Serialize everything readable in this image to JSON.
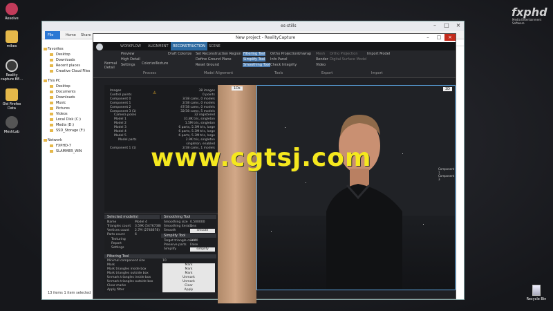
{
  "desktop": {
    "icons": [
      {
        "label": "Resolve",
        "color": "#c23b5a"
      },
      {
        "label": "mikes",
        "color": "#e5b84a"
      },
      {
        "label": "Reality capture BE...",
        "color": "#3a3a3a"
      },
      {
        "label": "Old Firefox Data",
        "color": "#e5b84a"
      },
      {
        "label": "MeshLab",
        "color": "#555"
      }
    ],
    "watermark": "fxphd",
    "watermark_sub": "Media Entertainment Software",
    "recycle_bin": "Recycle Bin",
    "overlay_text": "www.cgtsj.com"
  },
  "explorer": {
    "title": "es-stills",
    "tabs": [
      "File",
      "Home",
      "Share"
    ],
    "nav": [
      {
        "label": "Favorites",
        "h": true
      },
      {
        "label": "Desktop"
      },
      {
        "label": "Downloads"
      },
      {
        "label": "Recent places"
      },
      {
        "label": "Creative Cloud Files"
      },
      {
        "label": "This PC",
        "h": true
      },
      {
        "label": "Desktop"
      },
      {
        "label": "Documents"
      },
      {
        "label": "Downloads"
      },
      {
        "label": "Music"
      },
      {
        "label": "Pictures"
      },
      {
        "label": "Videos"
      },
      {
        "label": "Local Disk (C:)"
      },
      {
        "label": "Media (D:)"
      },
      {
        "label": "SSD_Storage (F:)"
      },
      {
        "label": "Network",
        "h": true
      },
      {
        "label": "FXPHD-7"
      },
      {
        "label": "SLAMMER_WIN"
      }
    ],
    "status": "13 items    1 item selected"
  },
  "rc": {
    "title": "New project - RealityCapture",
    "menu": [
      "WORKFLOW",
      "ALIGNMENT",
      "RECONSTRUCTION",
      "SCENE"
    ],
    "ribbon": {
      "col1": [
        "Normal Detail"
      ],
      "col2": [
        "Preview",
        "High Detail",
        "Settings"
      ],
      "col3": [
        "Colorize",
        "Texture"
      ],
      "col4": [
        "Draft Colorize"
      ],
      "col5": [
        "Set Reconstruction Region",
        "Define Ground Plane",
        "Reset Ground"
      ],
      "col6": [
        "Filtering Tool",
        "Simplify Tool",
        "Smoothing Tool"
      ],
      "col7": [
        "Ortho Projection",
        "Info Panel",
        "Check Integrity"
      ],
      "col8": [
        "Unwrap"
      ],
      "col9": [
        "Mesh",
        "Render",
        "Video"
      ],
      "col10": [
        "Ortho Projection",
        "Digital Surface Model"
      ],
      "col11": [
        "Import Model"
      ],
      "sections": [
        "Process",
        "Model Alignment",
        "Tools",
        "Export",
        "Import"
      ]
    },
    "tree": [
      {
        "k": "Images",
        "v": "38 images"
      },
      {
        "k": "Control points",
        "v": "0 points"
      },
      {
        "k": "Component 0",
        "v": "3/38 cams, 0 models"
      },
      {
        "k": "Component 1",
        "v": "2/38 cams, 0 models"
      },
      {
        "k": "Component 2",
        "v": "47/38 cams, 0 models"
      },
      {
        "k": "Component 3 (1)",
        "v": "32/38 cams, 5 models"
      },
      {
        "k": "Camera poses",
        "v": "32 registered"
      },
      {
        "k": "Model 1",
        "v": "31.8K tris, singleton"
      },
      {
        "k": "Model 2",
        "v": "1.5M tris, singleton"
      },
      {
        "k": "Model 3",
        "v": "6 parts, 5.3M tris, large"
      },
      {
        "k": "Model 4",
        "v": "6 parts, 5.3M tris, large"
      },
      {
        "k": "Model 5",
        "v": "6 parts, 5.3M tris, large"
      },
      {
        "k": "Model parts",
        "v": "2.9K tris, singleton"
      },
      {
        "k": "",
        "v": "singleton, enabled"
      },
      {
        "k": "Component 1 (1)",
        "v": "2/38 cams, 1 models"
      }
    ],
    "view_labels": {
      "v2": "1Ds",
      "v3": "3D",
      "v3b": "3D"
    },
    "selected": {
      "header": "Selected model(s)",
      "rows": [
        {
          "k": "Name",
          "v": "Model 4"
        },
        {
          "k": "Triangles count",
          "v": "3.59K (5476738)"
        },
        {
          "k": "Vertices count",
          "v": "2.7M (2748678)"
        },
        {
          "k": "Parts count",
          "v": "6"
        }
      ],
      "checks": [
        "Texturing",
        "Report",
        "Settings"
      ]
    },
    "smoothing": {
      "header": "Smoothing Tool",
      "rows": [
        {
          "k": "Smoothing size",
          "v": "0.500000"
        },
        {
          "k": "Smoothing iterations",
          "v": "1"
        },
        {
          "k": "Smooth",
          "v": "smooth"
        }
      ]
    },
    "simplify": {
      "header": "Simplify Tool",
      "rows": [
        {
          "k": "Target triangle count",
          "v": "3000"
        },
        {
          "k": "Preserve parts",
          "v": "False"
        },
        {
          "k": "Simplify",
          "v": "simplify"
        }
      ]
    },
    "filtering": {
      "header": "Filtering Tool",
      "rows": [
        {
          "k": "Minimal component size",
          "v": "10"
        },
        {
          "k": "Mark",
          "v": "Mark"
        },
        {
          "k": "Mark triangles inside box",
          "v": "Mark"
        },
        {
          "k": "Mark triangles outside box",
          "v": "Mark"
        },
        {
          "k": "Unmark triangles inside box",
          "v": "Unmark"
        },
        {
          "k": "Unmark triangles outside box",
          "v": "Unmark"
        },
        {
          "k": "Clear marks",
          "v": "Clear"
        },
        {
          "k": "Apply filter",
          "v": "Apply"
        }
      ]
    },
    "scene_labels": [
      "Component 1",
      "Component 3"
    ]
  }
}
